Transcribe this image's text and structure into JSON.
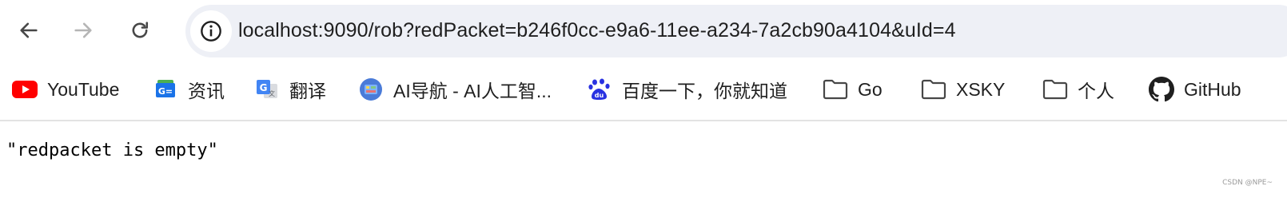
{
  "address_bar": {
    "url": "localhost:9090/rob?redPacket=b246f0cc-e9a6-11ee-a234-7a2cb90a4104&uId=4"
  },
  "bookmarks": [
    {
      "label": "YouTube",
      "icon": "youtube-icon"
    },
    {
      "label": "资讯",
      "icon": "google-news-icon"
    },
    {
      "label": "翻译",
      "icon": "google-translate-icon"
    },
    {
      "label": "AI导航 - AI人工智...",
      "icon": "ai-nav-icon"
    },
    {
      "label": "百度一下，你就知道",
      "icon": "baidu-icon"
    },
    {
      "label": "Go",
      "icon": "folder-icon"
    },
    {
      "label": "XSKY",
      "icon": "folder-icon"
    },
    {
      "label": "个人",
      "icon": "folder-icon"
    },
    {
      "label": "GitHub",
      "icon": "github-icon"
    }
  ],
  "page": {
    "body_text": "\"redpacket is empty\""
  },
  "watermark": "CSDN @NPE~",
  "colors": {
    "omnibox_bg": "#eef0f6",
    "youtube_red": "#ff0000",
    "baidu_blue": "#2932e1",
    "icon_gray": "#474747"
  }
}
